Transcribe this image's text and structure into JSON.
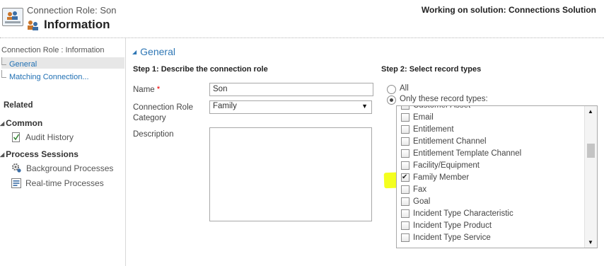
{
  "header": {
    "subtitle": "Connection Role: Son",
    "title": "Information",
    "solution": "Working on solution: Connections Solution"
  },
  "nav": {
    "breadcrumb": "Connection Role : Information",
    "sub_items": [
      {
        "label": "General",
        "selected": true
      },
      {
        "label": "Matching Connection..."
      }
    ],
    "related_label": "Related",
    "groups": [
      {
        "label": "Common",
        "items": [
          {
            "label": "Audit History",
            "icon": "audit-history-icon"
          }
        ]
      },
      {
        "label": "Process Sessions",
        "items": [
          {
            "label": "Background Processes",
            "icon": "background-process-icon"
          },
          {
            "label": "Real-time Processes",
            "icon": "realtime-process-icon"
          }
        ]
      }
    ]
  },
  "section": {
    "title": "General",
    "step1": "Step 1: Describe the connection role",
    "step2": "Step 2: Select record types"
  },
  "form": {
    "name_label": "Name",
    "required_marker": "*",
    "name_value": "Son",
    "category_label": "Connection Role Category",
    "category_value": "Family",
    "description_label": "Description",
    "description_value": ""
  },
  "record_types": {
    "radio_all": "All",
    "radio_only": "Only these record types:",
    "selected_option": "only",
    "highlight_color": "#f4ff1f",
    "items": [
      {
        "name": "Customer Asset",
        "checked": false
      },
      {
        "name": "Email",
        "checked": false
      },
      {
        "name": "Entitlement",
        "checked": false
      },
      {
        "name": "Entitlement Channel",
        "checked": false
      },
      {
        "name": "Entitlement Template Channel",
        "checked": false
      },
      {
        "name": "Facility/Equipment",
        "checked": false
      },
      {
        "name": "Family Member",
        "checked": true,
        "highlighted": true
      },
      {
        "name": "Fax",
        "checked": false
      },
      {
        "name": "Goal",
        "checked": false
      },
      {
        "name": "Incident Type Characteristic",
        "checked": false
      },
      {
        "name": "Incident Type Product",
        "checked": false
      },
      {
        "name": "Incident Type Service",
        "checked": false
      }
    ]
  },
  "colors": {
    "link_blue": "#1f6fb3",
    "section_blue": "#2f77b5",
    "nav_selected_bg": "#e7e7e7"
  }
}
